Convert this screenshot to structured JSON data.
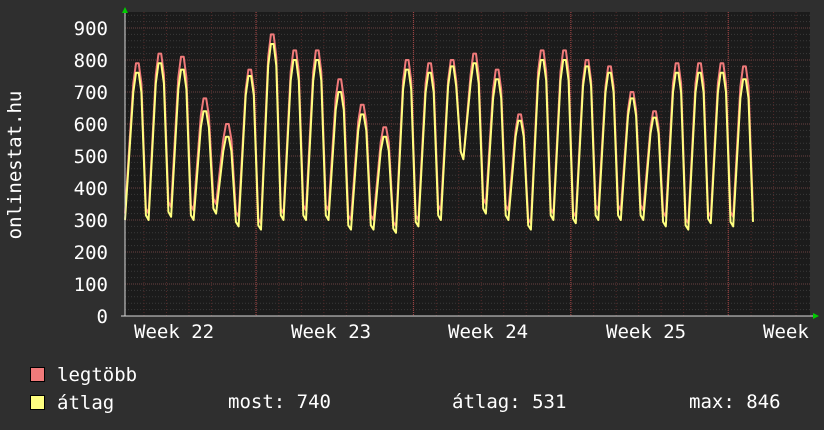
{
  "chart_data": {
    "type": "line",
    "ylabel": "onlinestat.hu",
    "ylim": [
      0,
      950
    ],
    "yticks": [
      0,
      100,
      200,
      300,
      400,
      500,
      600,
      700,
      800,
      900
    ],
    "x_labels": [
      "Week 22",
      "Week 23",
      "Week 24",
      "Week 25",
      "Week"
    ],
    "grid": true,
    "series": [
      {
        "name": "legtöbb",
        "color": "#f07a7a",
        "daily_peaks": [
          790,
          820,
          810,
          680,
          600,
          770,
          880,
          830,
          830,
          740,
          660,
          590,
          800,
          790,
          800,
          820,
          770,
          630,
          830,
          830,
          800,
          780,
          700,
          640,
          790,
          790,
          790,
          780
        ],
        "daily_troughs": [
          320,
          340,
          330,
          350,
          310,
          290,
          320,
          330,
          330,
          300,
          300,
          280,
          300,
          330,
          490,
          350,
          330,
          290,
          320,
          310,
          330,
          330,
          330,
          310,
          290,
          310,
          310
        ]
      },
      {
        "name": "átlag",
        "color": "#ffff80",
        "daily_peaks": [
          760,
          790,
          770,
          640,
          560,
          750,
          850,
          800,
          800,
          700,
          630,
          560,
          770,
          760,
          780,
          790,
          740,
          610,
          800,
          800,
          780,
          760,
          680,
          620,
          760,
          760,
          760,
          740
        ],
        "daily_troughs": [
          300,
          310,
          300,
          320,
          280,
          270,
          300,
          300,
          300,
          270,
          270,
          260,
          280,
          300,
          490,
          320,
          300,
          270,
          300,
          290,
          300,
          300,
          300,
          280,
          270,
          290,
          280
        ]
      }
    ]
  },
  "legend": {
    "max_label": "legtöbb",
    "avg_label": "átlag",
    "max_color": "#f07a7a",
    "avg_color": "#ffff80"
  },
  "stats": {
    "now": "most: 740",
    "avg": "átlag: 531",
    "max": "max: 846"
  }
}
